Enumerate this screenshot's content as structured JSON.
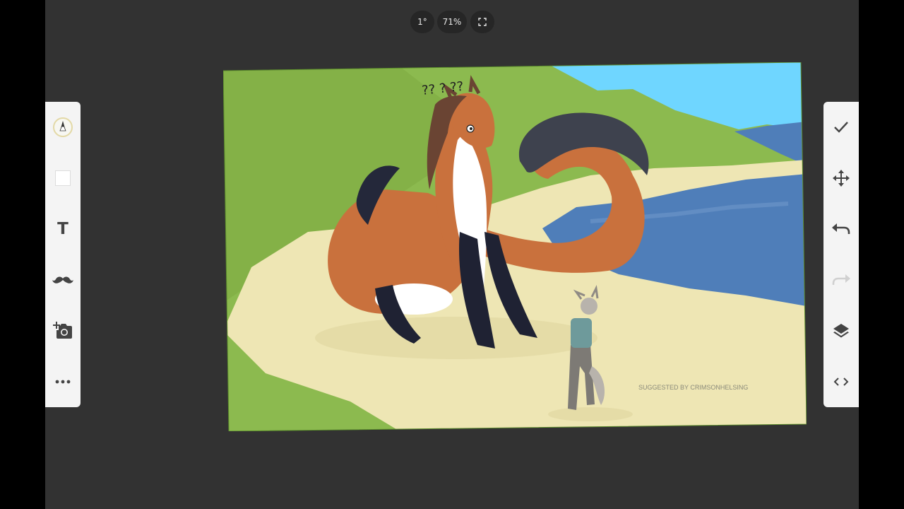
{
  "top_bar": {
    "rotation": "1°",
    "zoom": "71%",
    "fullscreen_icon": "fullscreen-icon"
  },
  "left_toolbar": {
    "tools": [
      {
        "name": "brush",
        "icon": "brush-icon"
      },
      {
        "name": "color",
        "icon": "color-swatch-icon",
        "color": "#ffffff"
      },
      {
        "name": "text",
        "icon": "text-icon",
        "label": "T"
      },
      {
        "name": "mustache",
        "icon": "mustache-icon"
      },
      {
        "name": "add-photo",
        "icon": "camera-add-icon"
      },
      {
        "name": "more",
        "icon": "more-icon"
      }
    ]
  },
  "right_toolbar": {
    "tools": [
      {
        "name": "confirm",
        "icon": "check-icon"
      },
      {
        "name": "move",
        "icon": "move-icon"
      },
      {
        "name": "undo",
        "icon": "undo-icon"
      },
      {
        "name": "redo",
        "icon": "redo-icon",
        "enabled": false
      },
      {
        "name": "layers",
        "icon": "layers-icon"
      },
      {
        "name": "code",
        "icon": "code-icon"
      }
    ]
  },
  "canvas": {
    "signature": "SUGGESTED BY CRIMSONHELSING",
    "question_marks": "?? ? ??",
    "colors": {
      "grass": "#8cba4f",
      "sky": "#6fd6ff",
      "water": "#4f7eb9",
      "sand": "#eee6b4",
      "fur": "#c9713d"
    }
  }
}
